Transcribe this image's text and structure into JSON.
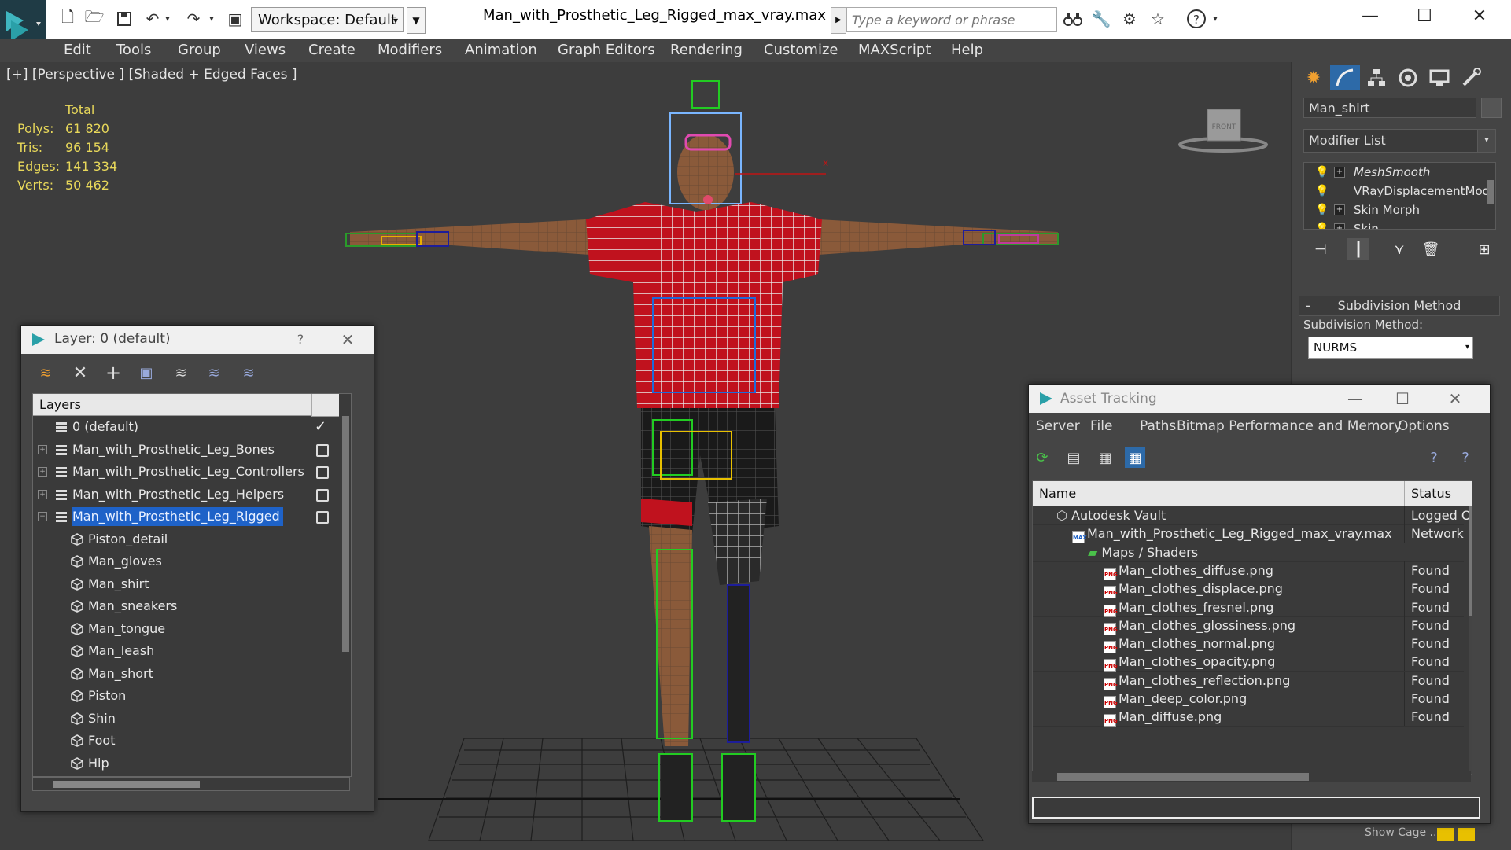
{
  "app": {
    "title": "Man_with_Prosthetic_Leg_Rigged_max_vray.max",
    "workspace": "Workspace: Default",
    "search_placeholder": "Type a keyword or phrase"
  },
  "menu": [
    "Edit",
    "Tools",
    "Group",
    "Views",
    "Create",
    "Modifiers",
    "Animation",
    "Graph Editors",
    "Rendering",
    "Customize",
    "MAXScript",
    "Help"
  ],
  "viewport": {
    "label": "[+] [Perspective ] [Shaded + Edged Faces ]",
    "stats": {
      "header": "Total",
      "rows": [
        {
          "label": "Polys:",
          "value": "61 820"
        },
        {
          "label": "Tris:",
          "value": "96 154"
        },
        {
          "label": "Edges:",
          "value": "141 334"
        },
        {
          "label": "Verts:",
          "value": "50 462"
        }
      ]
    },
    "viewcube_label": "FRONT"
  },
  "command_panel": {
    "object_name": "Man_shirt",
    "modifier_list": "Modifier List",
    "stack": [
      {
        "name": "MeshSmooth",
        "italic": true,
        "expand": true
      },
      {
        "name": "VRayDisplacementMod",
        "italic": false,
        "expand": false
      },
      {
        "name": "Skin Morph",
        "italic": false,
        "expand": true
      },
      {
        "name": "Skin",
        "italic": false,
        "expand": true
      }
    ],
    "rollout_title": "Subdivision Method",
    "subdivision_label": "Subdivision Method:",
    "subdivision_value": "NURMS",
    "show_cage": "Show Cage ......",
    "cage_colors": [
      "#e8c000",
      "#e8c000"
    ]
  },
  "layer_window": {
    "title": "Layer: 0 (default)",
    "help": "?",
    "header": "Layers",
    "layers": [
      {
        "name": "0 (default)",
        "level": 0,
        "expandable": false,
        "checked": true,
        "selected": false,
        "kind": "layer"
      },
      {
        "name": "Man_with_Prosthetic_Leg_Bones",
        "level": 0,
        "expandable": true,
        "checked": false,
        "selected": false,
        "kind": "layer"
      },
      {
        "name": "Man_with_Prosthetic_Leg_Controllers",
        "level": 0,
        "expandable": true,
        "checked": false,
        "selected": false,
        "kind": "layer"
      },
      {
        "name": "Man_with_Prosthetic_Leg_Helpers",
        "level": 0,
        "expandable": true,
        "checked": false,
        "selected": false,
        "kind": "layer"
      },
      {
        "name": "Man_with_Prosthetic_Leg_Rigged",
        "level": 0,
        "expandable": true,
        "expanded": true,
        "checked": false,
        "selected": true,
        "kind": "layer"
      },
      {
        "name": "Piston_detail",
        "level": 1,
        "kind": "object"
      },
      {
        "name": "Man_gloves",
        "level": 1,
        "kind": "object"
      },
      {
        "name": "Man_shirt",
        "level": 1,
        "kind": "object"
      },
      {
        "name": "Man_sneakers",
        "level": 1,
        "kind": "object"
      },
      {
        "name": "Man_tongue",
        "level": 1,
        "kind": "object"
      },
      {
        "name": "Man_leash",
        "level": 1,
        "kind": "object"
      },
      {
        "name": "Man_short",
        "level": 1,
        "kind": "object"
      },
      {
        "name": "Piston",
        "level": 1,
        "kind": "object"
      },
      {
        "name": "Shin",
        "level": 1,
        "kind": "object"
      },
      {
        "name": "Foot",
        "level": 1,
        "kind": "object"
      },
      {
        "name": "Hip",
        "level": 1,
        "kind": "object"
      }
    ]
  },
  "asset_window": {
    "title": "Asset Tracking",
    "menu": [
      "Server",
      "File",
      "Paths",
      "Bitmap Performance and Memory",
      "Options"
    ],
    "columns": [
      "Name",
      "Status"
    ],
    "rows": [
      {
        "name": "Autodesk Vault",
        "status": "Logged O",
        "indent": 0,
        "icon": "vault"
      },
      {
        "name": "Man_with_Prosthetic_Leg_Rigged_max_vray.max",
        "status": "Network",
        "indent": 1,
        "icon": "max"
      },
      {
        "name": "Maps / Shaders",
        "status": "",
        "indent": 2,
        "icon": "maps"
      },
      {
        "name": "Man_clothes_diffuse.png",
        "status": "Found",
        "indent": 3,
        "icon": "png"
      },
      {
        "name": "Man_clothes_displace.png",
        "status": "Found",
        "indent": 3,
        "icon": "png"
      },
      {
        "name": "Man_clothes_fresnel.png",
        "status": "Found",
        "indent": 3,
        "icon": "png"
      },
      {
        "name": "Man_clothes_glossiness.png",
        "status": "Found",
        "indent": 3,
        "icon": "png"
      },
      {
        "name": "Man_clothes_normal.png",
        "status": "Found",
        "indent": 3,
        "icon": "png"
      },
      {
        "name": "Man_clothes_opacity.png",
        "status": "Found",
        "indent": 3,
        "icon": "png"
      },
      {
        "name": "Man_clothes_reflection.png",
        "status": "Found",
        "indent": 3,
        "icon": "png"
      },
      {
        "name": "Man_deep_color.png",
        "status": "Found",
        "indent": 3,
        "icon": "png"
      },
      {
        "name": "Man_diffuse.png",
        "status": "Found",
        "indent": 3,
        "icon": "png"
      }
    ]
  },
  "colors": {
    "selection": "#1e62c8",
    "stats_text": "#e8d85a",
    "shirt": "#c0121e",
    "skin": "#8a5a3a"
  }
}
